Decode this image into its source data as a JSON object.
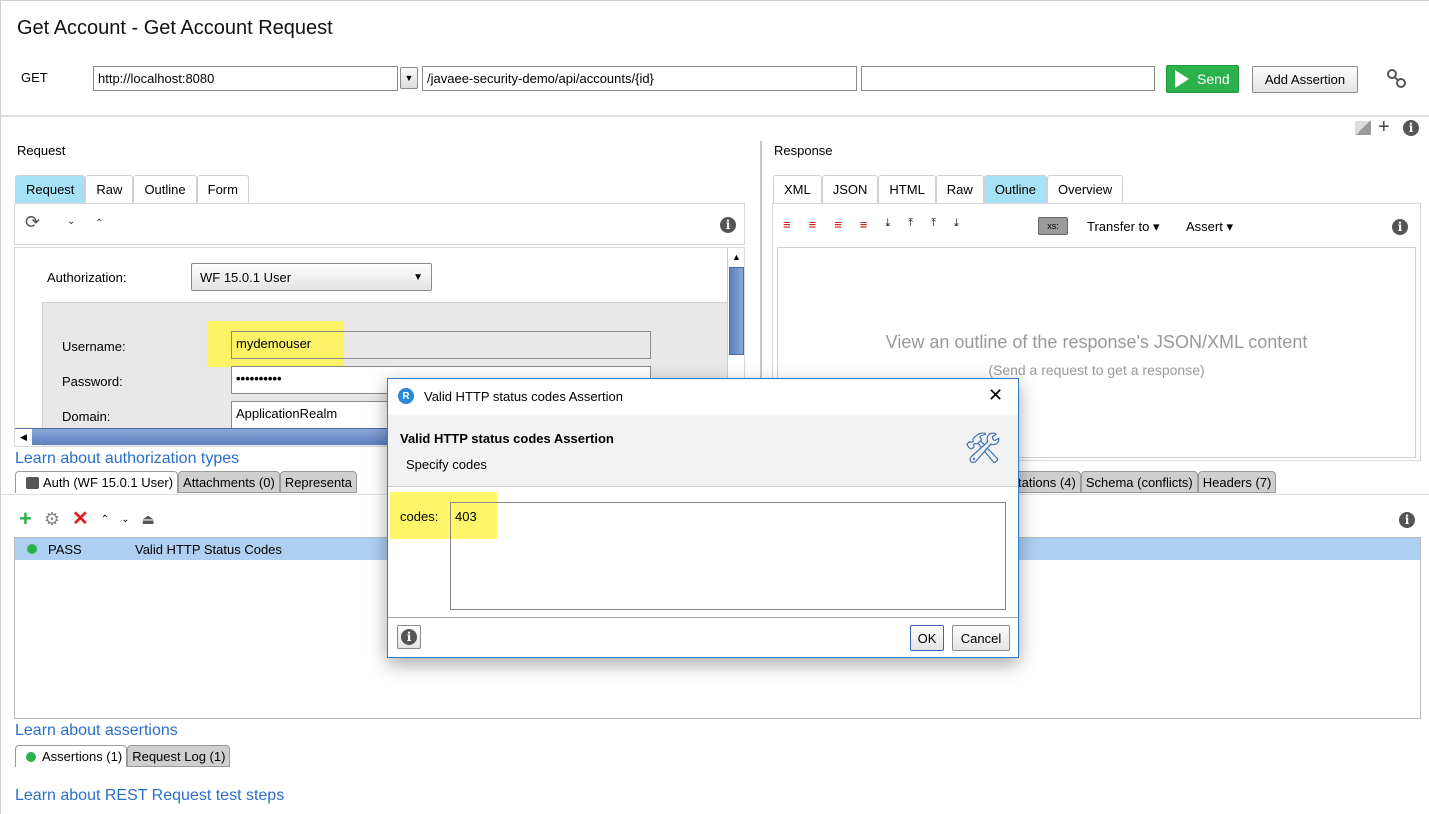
{
  "window": {
    "title": "Get Account - Get Account Request"
  },
  "request_bar": {
    "method": "GET",
    "endpoint": "http://localhost:8080",
    "resource": "/javaee-security-demo/api/accounts/{id}",
    "params": "",
    "send_label": "Send",
    "add_assertion_label": "Add Assertion"
  },
  "request_panel": {
    "label": "Request",
    "tabs": [
      {
        "label": "Request",
        "active": true
      },
      {
        "label": "Raw",
        "active": false
      },
      {
        "label": "Outline",
        "active": false
      },
      {
        "label": "Form",
        "active": false
      }
    ],
    "auth": {
      "authorization_label": "Authorization:",
      "authorization_value": "WF 15.0.1 User",
      "username_label": "Username:",
      "username_value": "mydemouser",
      "password_label": "Password:",
      "password_value": "••••••••••",
      "domain_label": "Domain:",
      "domain_value": "ApplicationRealm"
    },
    "learn_link": "Learn about authorization types",
    "bottom_tabs": [
      {
        "label": "Auth (WF 15.0.1 User)",
        "active": true,
        "icon": "lock-icon"
      },
      {
        "label": "Attachments (0)",
        "active": false
      },
      {
        "label": "Representa",
        "active": false
      }
    ]
  },
  "response_panel": {
    "label": "Response",
    "tabs": [
      {
        "label": "XML",
        "active": false
      },
      {
        "label": "JSON",
        "active": false
      },
      {
        "label": "HTML",
        "active": false
      },
      {
        "label": "Raw",
        "active": false
      },
      {
        "label": "Outline",
        "active": true
      },
      {
        "label": "Overview",
        "active": false
      }
    ],
    "toolbar": {
      "xs_label": "xs:",
      "transfer_label": "Transfer to",
      "assert_label": "Assert"
    },
    "empty_title": "View an outline of the response's JSON/XML content",
    "empty_subtitle": "(Send a request to get a response)",
    "bottom_tabs": [
      {
        "label": "tations (4)",
        "active": false
      },
      {
        "label": "Schema (conflicts)",
        "active": false
      },
      {
        "label": "Headers (7)",
        "active": false
      }
    ]
  },
  "assertions": {
    "rows": [
      {
        "status": "PASS",
        "name": "Valid HTTP Status Codes",
        "status_color": "#2bb24c"
      }
    ],
    "learn_link": "Learn about assertions",
    "bottom_tabs": [
      {
        "label": "Assertions (1)",
        "active": true
      },
      {
        "label": "Request Log (1)",
        "active": false
      }
    ]
  },
  "footer": {
    "learn_link": "Learn about REST Request test steps"
  },
  "dialog": {
    "title": "Valid HTTP status codes Assertion",
    "heading": "Valid HTTP status codes Assertion",
    "subheading": "Specify codes",
    "codes_label": "codes:",
    "codes_value": "403",
    "ok_label": "OK",
    "cancel_label": "Cancel"
  },
  "colors": {
    "accent_tab": "#a6e2f7",
    "send_green": "#2bb24c",
    "link_blue": "#2a6fc9",
    "highlight_yellow": "#fff34d",
    "selected_row": "#aed0f3"
  }
}
